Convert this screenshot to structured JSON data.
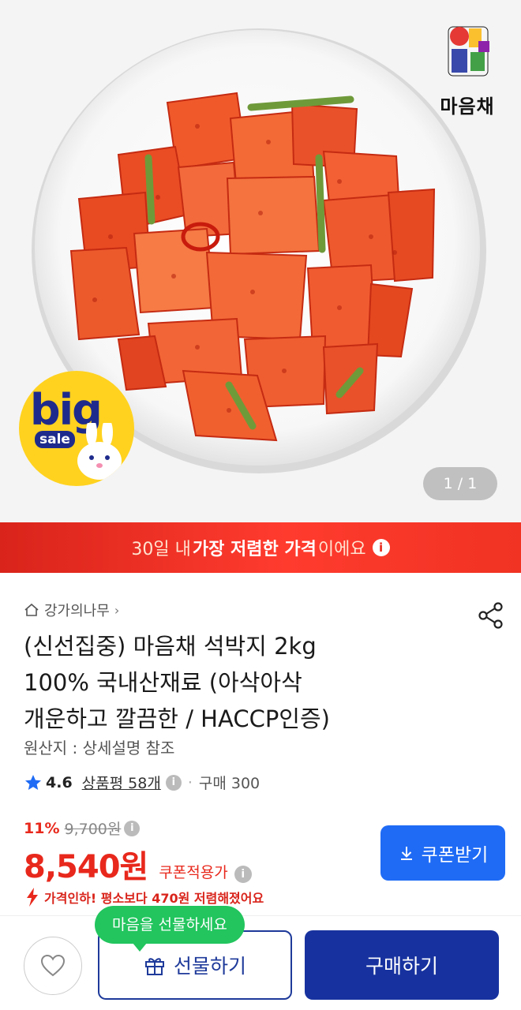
{
  "hero": {
    "brand_name": "마음채",
    "badge_big": "big",
    "badge_sale": "sale",
    "page_indicator": "1 / 1",
    "icons": [
      "brand-logo",
      "big-sale-badge",
      "bunny-mascot"
    ]
  },
  "banner": {
    "prefix": "30일 내",
    "highlight": "가장 저렴한 가격",
    "suffix": "이에요",
    "info_icon": "i",
    "color": "#e8281c"
  },
  "product": {
    "breadcrumb": "강가의나무",
    "title_line1": "(신선집중) 마음채 석박지 2kg",
    "title_line2": "100% 국내산재료 (아삭아삭",
    "title_line3": "개운하고 깔끔한 / HACCP인증)",
    "origin": "원산지 : 상세설명 참조",
    "rating": "4.6",
    "reviews": "상품평 58개",
    "purchases": "구매 300",
    "info_icon": "i"
  },
  "price": {
    "discount_pct": "11%",
    "original_price": "9,700원",
    "final_price": "8,540원",
    "coupon_note": "쿠폰적용가",
    "coupon_button": "쿠폰받기",
    "price_drop_note": "가격인하! 평소보다 470원 저렴해졌어요",
    "accent": "#e8281c",
    "button_color": "#1f6bf5"
  },
  "bottom_bar": {
    "tooltip": "마음을 선물하세요",
    "gift_button": "선물하기",
    "buy_button": "구매하기",
    "buy_color": "#17329f",
    "tooltip_color": "#22c55e"
  }
}
